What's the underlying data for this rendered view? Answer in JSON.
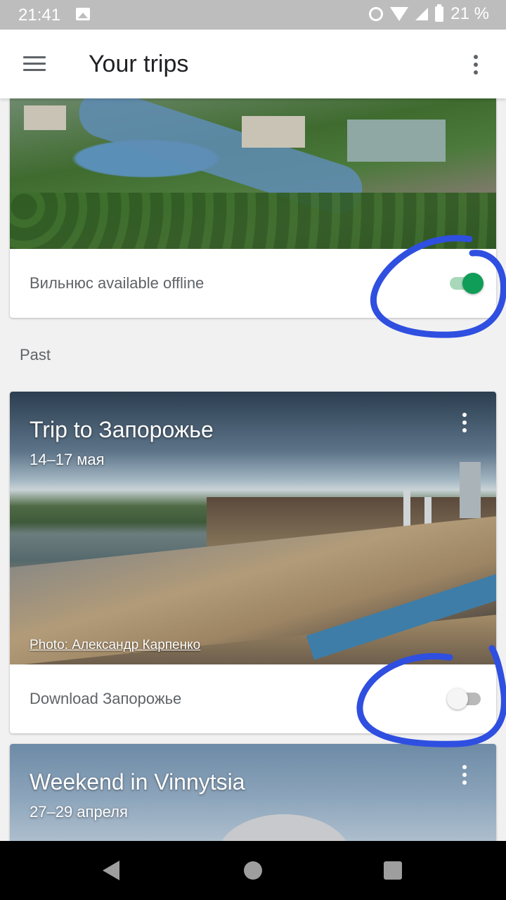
{
  "status_bar": {
    "time": "21:41",
    "battery_percent": "21 %",
    "icons": [
      "image-icon",
      "alarm-icon",
      "wifi-icon",
      "cell-signal-icon",
      "battery-icon"
    ]
  },
  "app_bar": {
    "title": "Your trips",
    "icons": [
      "menu-icon",
      "more-vert-icon"
    ]
  },
  "trips": {
    "vilnius": {
      "offline_label": "Вильнюс available offline",
      "offline_enabled": true
    },
    "section_past": "Past",
    "zaporozhye": {
      "title": "Trip to Запорожье",
      "dates": "14–17 мая",
      "photo_credit": "Photo: Александр Карпенко",
      "download_label": "Download Запорожье",
      "download_enabled": false
    },
    "vinnytsia": {
      "title": "Weekend in Vinnytsia",
      "dates": "27–29 апреля"
    }
  },
  "colors": {
    "accent_green": "#0f9d58",
    "annotation_blue": "#2f4fe0"
  }
}
